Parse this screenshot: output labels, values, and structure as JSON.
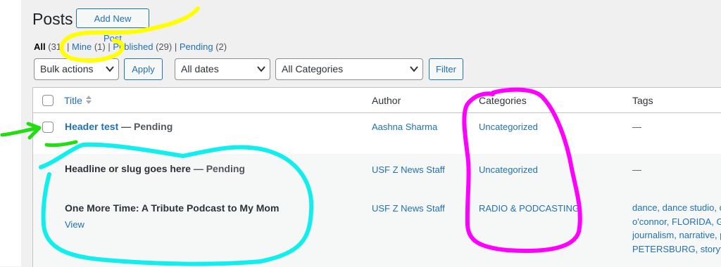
{
  "header": {
    "title": "Posts",
    "add_new": "Add New Post"
  },
  "views": {
    "all": "All",
    "all_count": "(31)",
    "mine": "Mine",
    "mine_count": "(1)",
    "published": "Published",
    "published_count": "(29)",
    "pending": "Pending",
    "pending_count": "(2)",
    "sep": "|"
  },
  "filters": {
    "bulk_actions": "Bulk actions",
    "apply": "Apply",
    "dates": "All dates",
    "categories": "All Categories",
    "filter": "Filter"
  },
  "columns": {
    "title": "Title",
    "author": "Author",
    "categories": "Categories",
    "tags": "Tags"
  },
  "rows": [
    {
      "title": "Header test",
      "state": "— Pending",
      "author": "Aashna Sharma",
      "categories": "Uncategorized",
      "tags": "—"
    },
    {
      "title": "Headline or slug goes here",
      "state": "— Pending",
      "author": "USF Z News Staff",
      "categories": "Uncategorized",
      "tags": "—"
    },
    {
      "title": "One More Time: A Tribute Podcast to My Mom",
      "state": "",
      "author": "USF Z News Staff",
      "categories": "RADIO & PODCASTING",
      "action": "View",
      "tags_lines": [
        "dance, dance studio, o",
        "o'connor, FLORIDA, Gl",
        "journalism, narrative, p",
        "PETERSBURG, storytell"
      ]
    }
  ],
  "annotation_colors": {
    "yellow": "#ffff00",
    "green": "#22dd11",
    "cyan": "#11eeee",
    "magenta": "#ff00ff"
  },
  "icons": {
    "chevron": "chevron-down-icon",
    "sort": "sort-icon"
  }
}
